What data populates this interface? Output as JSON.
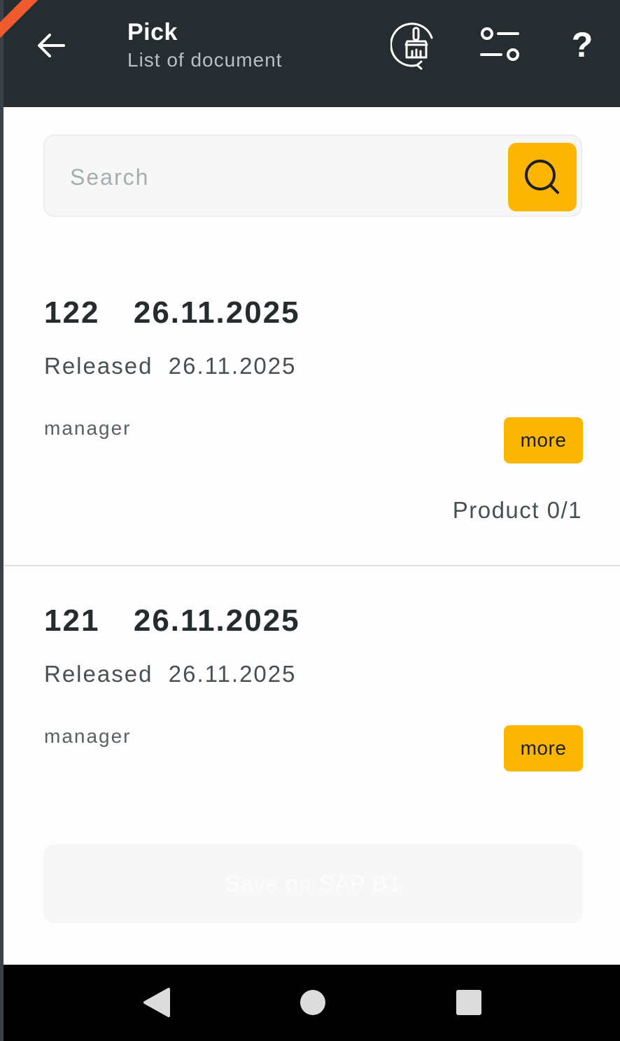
{
  "appbar": {
    "title": "Pick",
    "subtitle": "List of document",
    "back_icon": "arrow-left-icon",
    "actions": [
      {
        "name": "clean-icon"
      },
      {
        "name": "filter-settings-icon"
      },
      {
        "name": "help-icon",
        "glyph": "?"
      }
    ]
  },
  "search": {
    "placeholder": "Search",
    "value": "",
    "button_icon": "search-icon"
  },
  "documents": [
    {
      "title": "122  26.11.2025",
      "status": "Released  26.11.2025",
      "user": "manager",
      "more_label": "more",
      "product": "Product 0/1"
    },
    {
      "title": "121  26.11.2025",
      "status": "Released  26.11.2025",
      "user": "manager",
      "more_label": "more"
    }
  ],
  "footer": {
    "save_label": "Save on SAP B1"
  },
  "colors": {
    "appbar": "#262d31",
    "accent": "#fdb603",
    "background": "#fdfefd"
  }
}
